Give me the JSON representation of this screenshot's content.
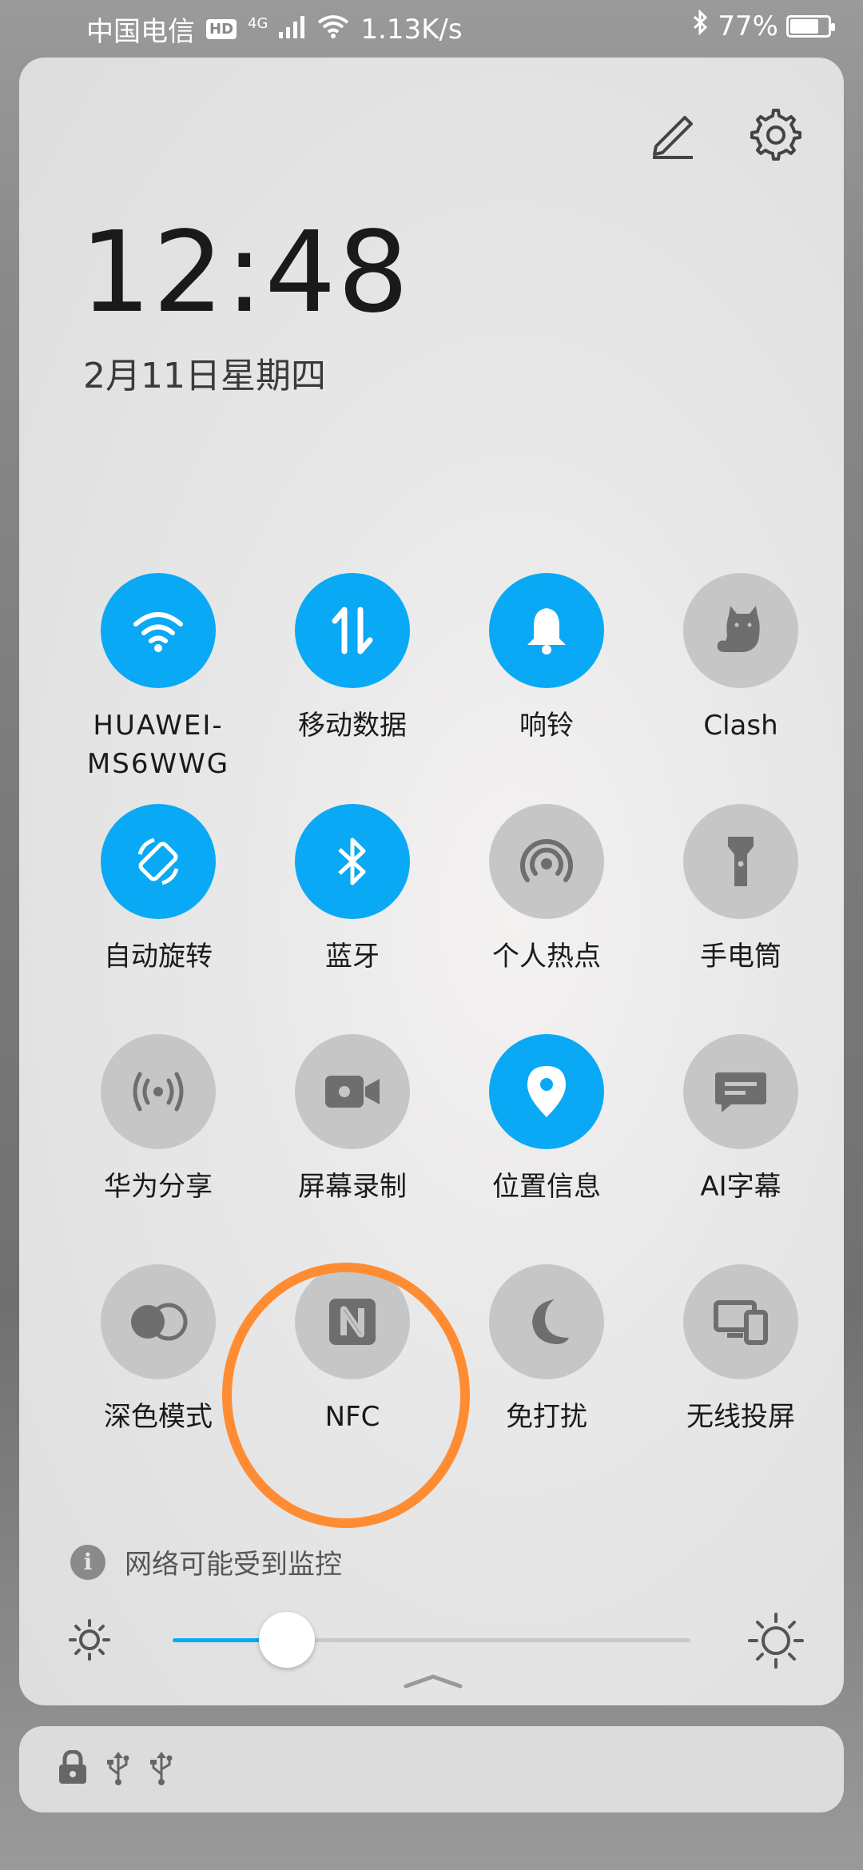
{
  "status_bar": {
    "carrier": "中国电信",
    "hd_badge": "HD",
    "network": "4G",
    "speed": "1.13K/s",
    "battery_percent": "77%",
    "battery_level": 0.77
  },
  "header": {
    "time": "12:48",
    "date": "2月11日星期四"
  },
  "tiles": [
    {
      "label": "HUAWEI-\nMS6WWG",
      "icon": "wifi-icon",
      "on": true
    },
    {
      "label": "移动数据",
      "icon": "mobile-data-icon",
      "on": true
    },
    {
      "label": "响铃",
      "icon": "bell-icon",
      "on": true
    },
    {
      "label": "Clash",
      "icon": "cat-icon",
      "on": false
    },
    {
      "label": "自动旋转",
      "icon": "rotate-icon",
      "on": true
    },
    {
      "label": "蓝牙",
      "icon": "bluetooth-icon",
      "on": true
    },
    {
      "label": "个人热点",
      "icon": "hotspot-icon",
      "on": false
    },
    {
      "label": "手电筒",
      "icon": "flashlight-icon",
      "on": false
    },
    {
      "label": "华为分享",
      "icon": "share-icon",
      "on": false
    },
    {
      "label": "屏幕录制",
      "icon": "screen-record-icon",
      "on": false
    },
    {
      "label": "位置信息",
      "icon": "location-icon",
      "on": true
    },
    {
      "label": "AI字幕",
      "icon": "subtitle-icon",
      "on": false
    },
    {
      "label": "深色模式",
      "icon": "dark-mode-icon",
      "on": false
    },
    {
      "label": "NFC",
      "icon": "nfc-icon",
      "on": false
    },
    {
      "label": "免打扰",
      "icon": "moon-icon",
      "on": false
    },
    {
      "label": "无线投屏",
      "icon": "cast-icon",
      "on": false
    }
  ],
  "notice": {
    "text": "网络可能受到监控"
  },
  "brightness": {
    "level": 0.22
  },
  "colors": {
    "accent": "#0aa9f5",
    "tile_off": "#c6c6c6",
    "highlight_ring": "#ff8c33"
  }
}
